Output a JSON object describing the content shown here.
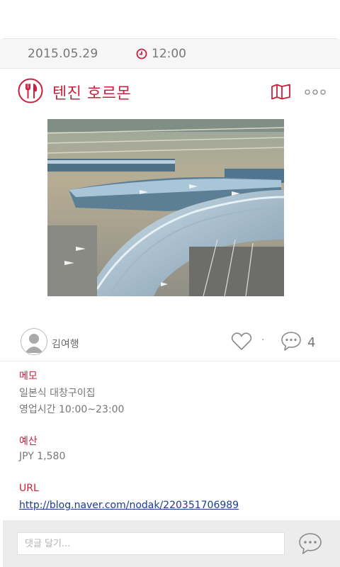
{
  "post": {
    "date": "2015.05.29",
    "time": "12:00",
    "place_title": "텐진 호르몬",
    "photo_alt": "airport terminal aerial view"
  },
  "author": {
    "name": "김여행",
    "separator": "·",
    "comment_count": "4"
  },
  "info": {
    "memo_label": "메모",
    "memo_line1": "일본식 대창구이집",
    "memo_line2": "영업시간 10:00~23:00",
    "budget_label": "예산",
    "budget_value": "JPY 1,580",
    "url_label": "URL",
    "url_value": "http://blog.naver.com/nodak/220351706989"
  },
  "comment_bar": {
    "placeholder": "댓글 달기..."
  },
  "colors": {
    "accent": "#cc1f3d",
    "link": "#1a3e8c",
    "muted": "#777777"
  },
  "icons": [
    "clock-icon",
    "restaurant-icon",
    "map-icon",
    "more-icon",
    "avatar-icon",
    "heart-icon",
    "comment-icon",
    "chat-icon"
  ]
}
